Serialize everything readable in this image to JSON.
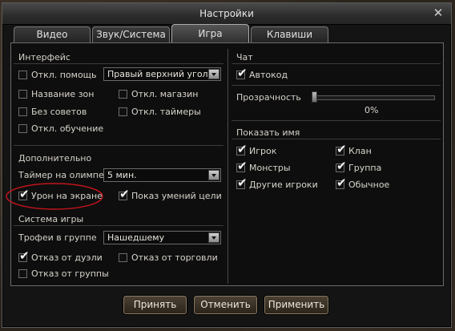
{
  "window": {
    "title": "Настройки"
  },
  "tabs": [
    {
      "label": "Видео"
    },
    {
      "label": "Звук/Система"
    },
    {
      "label": "Игра"
    },
    {
      "label": "Клавиши"
    }
  ],
  "left": {
    "interface": {
      "title": "Интерфейс",
      "help": {
        "label": "Откл. помощь",
        "checked": false
      },
      "help_position": {
        "value": "Правый верхний угол"
      },
      "zone_names": {
        "label": "Название зон",
        "checked": false
      },
      "disable_shop": {
        "label": "Откл. магазин",
        "checked": false
      },
      "no_tips": {
        "label": "Без советов",
        "checked": false
      },
      "disable_timers": {
        "label": "Откл. таймеры",
        "checked": false
      },
      "disable_tutorial": {
        "label": "Откл. обучение",
        "checked": false
      }
    },
    "extra": {
      "title": "Дополнительно",
      "olympiad_timer": {
        "label": "Таймер на олимпе",
        "value": "5 мин."
      },
      "damage_on_screen": {
        "label": "Урон на экране",
        "checked": true
      },
      "target_skills": {
        "label": "Показ умений цели",
        "checked": true
      }
    },
    "game_system": {
      "title": "Система игры",
      "party_loot": {
        "label": "Трофеи в группе",
        "value": "Нашедшему"
      },
      "refuse_duel": {
        "label": "Отказ от дуэли",
        "checked": true
      },
      "refuse_trade": {
        "label": "Отказ от торговли",
        "checked": false
      },
      "refuse_party": {
        "label": "Отказ от группы",
        "checked": false
      }
    }
  },
  "right": {
    "chat": {
      "title": "Чат",
      "autocode": {
        "label": "Автокод",
        "checked": true
      },
      "transparency": {
        "label": "Прозрачность",
        "value_text": "0%",
        "value": 0
      }
    },
    "show_name": {
      "title": "Показать имя",
      "player": {
        "label": "Игрок",
        "checked": true
      },
      "clan": {
        "label": "Клан",
        "checked": true
      },
      "monsters": {
        "label": "Монстры",
        "checked": true
      },
      "party": {
        "label": "Группа",
        "checked": true
      },
      "other_players": {
        "label": "Другие игроки",
        "checked": true
      },
      "normal": {
        "label": "Обычное",
        "checked": true
      }
    }
  },
  "buttons": {
    "accept": "Принять",
    "cancel": "Отменить",
    "apply": "Применить"
  },
  "icons": {
    "close": "close-icon",
    "check": "check-icon",
    "dropdown": "chevron-down-icon"
  },
  "colors": {
    "window_bg": "#141414",
    "highlight_circle": "#c0141c"
  }
}
